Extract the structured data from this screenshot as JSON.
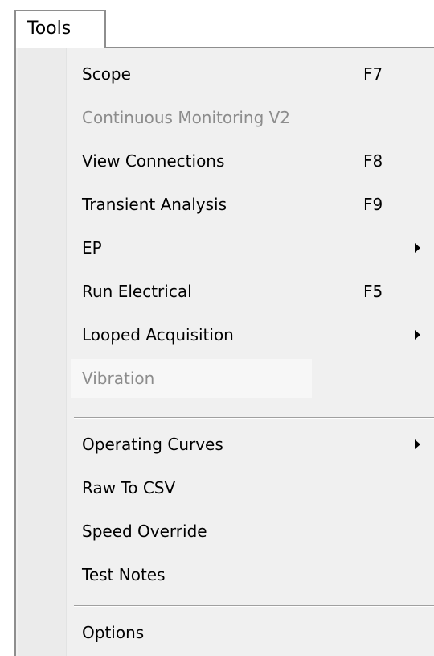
{
  "menubar": {
    "tab_label": "Tools"
  },
  "menu": {
    "groups": [
      [
        {
          "label": "Scope",
          "shortcut": "F7",
          "submenu": false,
          "disabled": false
        },
        {
          "label": "Continuous Monitoring V2",
          "shortcut": "",
          "submenu": false,
          "disabled": true
        },
        {
          "label": "View Connections",
          "shortcut": "F8",
          "submenu": false,
          "disabled": false
        },
        {
          "label": "Transient Analysis",
          "shortcut": "F9",
          "submenu": false,
          "disabled": false
        },
        {
          "label": "EP",
          "shortcut": "",
          "submenu": true,
          "disabled": false
        },
        {
          "label": "Run Electrical",
          "shortcut": "F5",
          "submenu": false,
          "disabled": false
        },
        {
          "label": "Looped Acquisition",
          "shortcut": "",
          "submenu": true,
          "disabled": false
        },
        {
          "label": "Vibration",
          "shortcut": "",
          "submenu": false,
          "disabled": true
        }
      ],
      [
        {
          "label": "Operating Curves",
          "shortcut": "",
          "submenu": true,
          "disabled": false
        },
        {
          "label": "Raw To CSV",
          "shortcut": "",
          "submenu": false,
          "disabled": false
        },
        {
          "label": "Speed Override",
          "shortcut": "",
          "submenu": false,
          "disabled": false
        },
        {
          "label": "Test Notes",
          "shortcut": "",
          "submenu": false,
          "disabled": false
        }
      ],
      [
        {
          "label": "Options",
          "shortcut": "",
          "submenu": false,
          "disabled": false
        }
      ]
    ]
  },
  "colors": {
    "menu_background": "#f0f0f0",
    "icon_gutter": "#ebebeb",
    "border": "#8e8e8e",
    "disabled_text": "#8c8c8c",
    "text": "#000000"
  }
}
